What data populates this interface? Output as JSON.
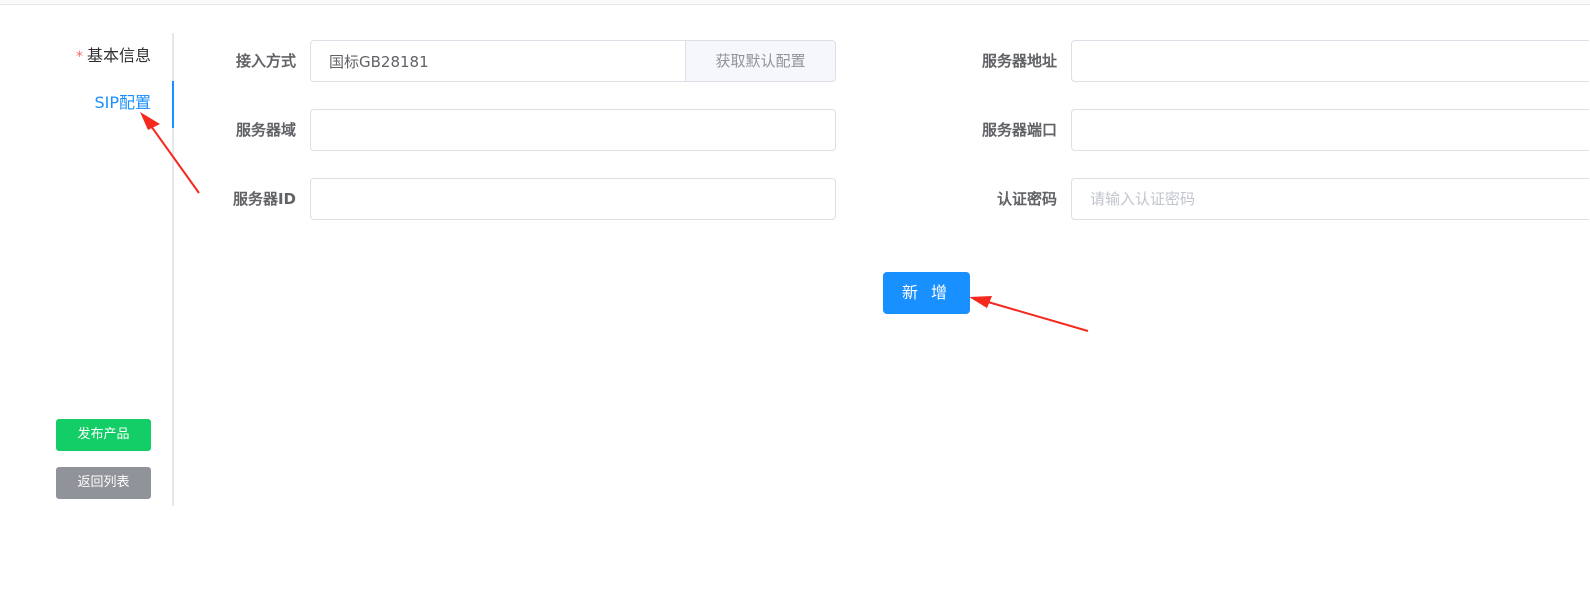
{
  "tabs": {
    "items": [
      {
        "label": "基本信息",
        "required_mark": "*"
      },
      {
        "label": "SIP配置"
      }
    ],
    "active_index": 1
  },
  "side_actions": {
    "publish_label": "发布产品",
    "back_label": "返回列表"
  },
  "form": {
    "access_mode": {
      "label": "接入方式",
      "value": "国标GB28181",
      "append_label": "获取默认配置"
    },
    "server_domain": {
      "label": "服务器域",
      "value": ""
    },
    "server_id": {
      "label": "服务器ID",
      "value": ""
    },
    "server_address": {
      "label": "服务器地址",
      "value": ""
    },
    "server_port": {
      "label": "服务器端口",
      "value": ""
    },
    "auth_password": {
      "label": "认证密码",
      "value": "",
      "placeholder": "请输入认证密码"
    },
    "submit_label": "新 增"
  },
  "colors": {
    "primary": "#1890ff",
    "success": "#13ce66",
    "info": "#909399",
    "annotation_arrow": "#f5291e"
  }
}
